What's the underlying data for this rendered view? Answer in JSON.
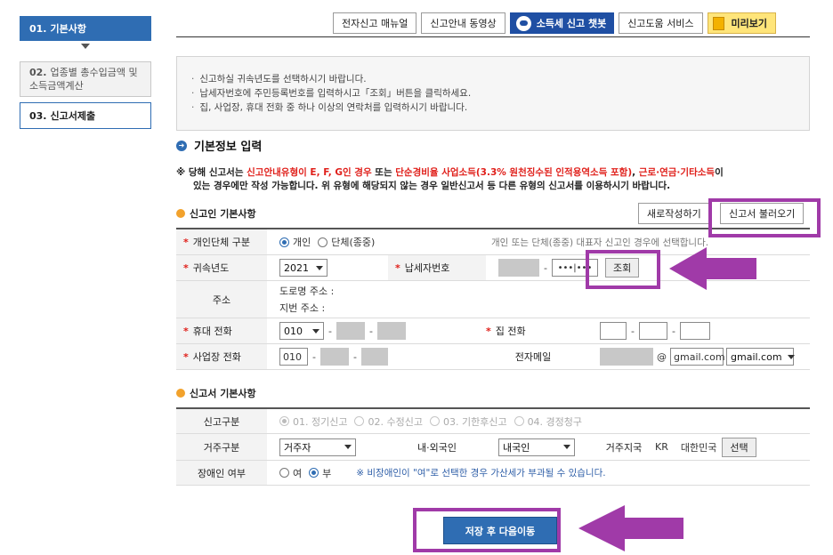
{
  "steps": [
    {
      "num": "01.",
      "label": "기본사항"
    },
    {
      "num": "02.",
      "label": "업종별 총수입금액 및 소득금액계산"
    },
    {
      "num": "03.",
      "label": "신고서제출"
    }
  ],
  "toolbar": {
    "manual": "전자신고 매뉴얼",
    "video": "신고안내 동영상",
    "chatbot": "소득세 신고 챗봇",
    "help_service": "신고도움 서비스",
    "preview": "미리보기"
  },
  "notice": [
    "신고하실 귀속년도를 선택하시기 바랍니다.",
    "납세자번호에 주민등록번호를 입력하시고「조회」버튼을 클릭하세요.",
    "집, 사업장, 휴대 전화 중 하나 이상의 연락처를 입력하시기 바랍니다."
  ],
  "section_title": "기본정보 입력",
  "warning": {
    "p1": "※ 당해 신고서는 ",
    "p2": "신고안내유형이 E, F, G인 경우",
    "p3": " 또는 ",
    "p4": "단순경비율 사업소득(3.3% 원천징수된 인적용역소득 포함)",
    "p5": ", ",
    "p6": "근로·연금·기타소득",
    "p7": "이",
    "line2": "있는 경우에만 작성 가능합니다. 위 유형에 해당되지 않는 경우 일반신고서 등 다른 유형의 신고서를 이용하시기 바랍니다."
  },
  "filer": {
    "title": "신고인 기본사항",
    "new_btn": "새로작성하기",
    "load_btn": "신고서 불러오기",
    "type_label": "개인단체 구분",
    "type_opt1": "개인",
    "type_opt2": "단체(종중)",
    "type_hint": "개인 또는 단체(종중) 대표자 신고인 경우에 선택합니다.",
    "year_label": "귀속년도",
    "year_value": "2021",
    "taxno_label": "납세자번호",
    "taxno_masked": "•••|•••",
    "lookup_btn": "조회",
    "addr_label": "주소",
    "addr_road": "도로명 주소 :",
    "addr_lot": "지번 주소 :",
    "mobile_label": "휴대 전화",
    "mobile_prefix": "010",
    "home_label": "집 전화",
    "biz_label": "사업장 전화",
    "biz_prefix": "010",
    "email_label": "전자메일",
    "email_at": "@",
    "email_domain": "gmail.com",
    "email_select": "gmail.com"
  },
  "report": {
    "title": "신고서 기본사항",
    "kind_label": "신고구분",
    "kind_opts": [
      "01. 정기신고",
      "02. 수정신고",
      "03. 기한후신고",
      "04. 경정청구"
    ],
    "residence_label": "거주구분",
    "residence_value": "거주자",
    "nationality_label": "내·외국인",
    "nationality_value": "내국인",
    "country_label": "거주지국",
    "country_code": "KR",
    "country_name": "대한민국",
    "select_btn": "선택",
    "disabled_label": "장애인 여부",
    "disabled_yes": "여",
    "disabled_no": "부",
    "disabled_note": "※ 비장애인이 \"여\"로 선택한 경우 가산세가 부과될 수 있습니다."
  },
  "save_btn": "저장 후 다음이동",
  "colors": {
    "accent": "#2f6db3",
    "annotation": "#a03aa8",
    "warning_red": "#e0201b"
  }
}
